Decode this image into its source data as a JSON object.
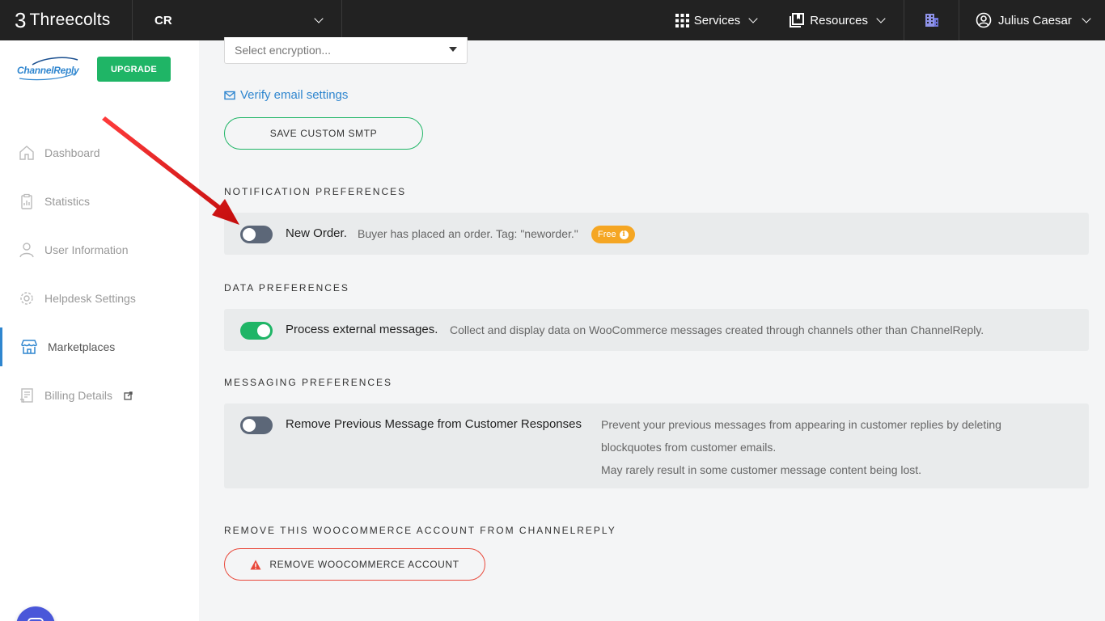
{
  "topbar": {
    "brand_mark": "3",
    "brand": "Threecolts",
    "account": "CR",
    "services": "Services",
    "resources": "Resources",
    "user": "Julius Caesar"
  },
  "sidebar": {
    "brand": "ChannelReply",
    "upgrade": "UPGRADE",
    "items": [
      {
        "label": "Dashboard",
        "icon": "home-icon"
      },
      {
        "label": "Statistics",
        "icon": "clipboard-chart-icon"
      },
      {
        "label": "User Information",
        "icon": "user-icon"
      },
      {
        "label": "Helpdesk Settings",
        "icon": "gear-icon"
      },
      {
        "label": "Marketplaces",
        "icon": "store-icon",
        "active": true
      },
      {
        "label": "Billing Details",
        "icon": "invoice-icon"
      }
    ]
  },
  "main": {
    "encryption": {
      "placeholder": "Select encryption..."
    },
    "verify_link": "Verify email settings",
    "save_smtp": "SAVE CUSTOM SMTP",
    "notification": {
      "title": "NOTIFICATION PREFERENCES",
      "new_order": {
        "label": "New Order.",
        "desc": "Buyer has placed an order. Tag: \"neworder.\"",
        "badge": "Free",
        "enabled": false
      }
    },
    "data": {
      "title": "DATA PREFERENCES",
      "external": {
        "label": "Process external messages.",
        "desc": "Collect and display data on WooCommerce messages created through channels other than ChannelReply.",
        "enabled": true
      }
    },
    "messaging": {
      "title": "MESSAGING PREFERENCES",
      "remove_prev": {
        "label": "Remove Previous Message from Customer Responses",
        "desc_line1": "Prevent your previous messages from appearing in customer replies by deleting",
        "desc_line2": "blockquotes from customer emails.",
        "desc_line3": "May rarely result in some customer message content being lost.",
        "enabled": false
      }
    },
    "remove_section": {
      "title": "REMOVE THIS WOOCOMMERCE ACCOUNT FROM CHANNELREPLY",
      "button": "REMOVE WOOCOMMERCE ACCOUNT"
    }
  },
  "colors": {
    "accent_green": "#1fb566",
    "link_blue": "#2f86cf",
    "danger_red": "#e8483a",
    "badge_orange": "#f5a623",
    "annotation_arrow": "#e01b1b"
  }
}
